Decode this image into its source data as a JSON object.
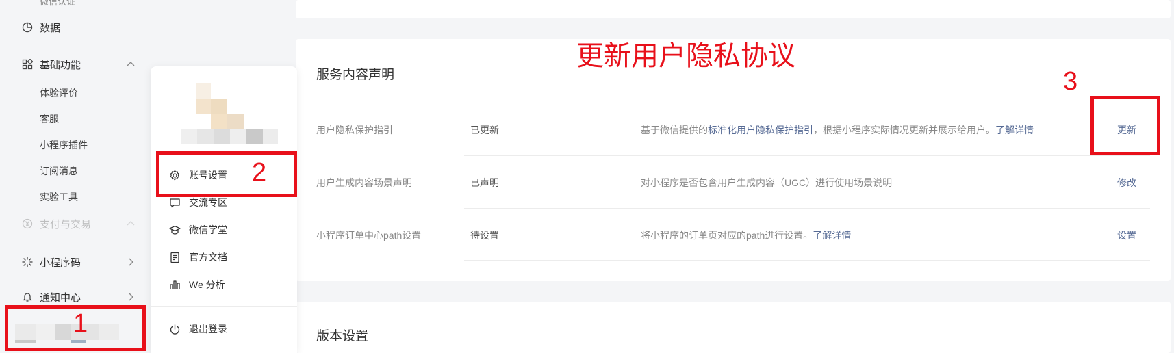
{
  "sidebar": {
    "top_item": "微信认证",
    "data_label": "数据",
    "basic_label": "基础功能",
    "basic_items": [
      "体验评价",
      "客服",
      "小程序插件",
      "订阅消息",
      "实验工具"
    ],
    "pay_label": "支付与交易",
    "qrcode_label": "小程序码",
    "notify_label": "通知中心"
  },
  "user_menu": {
    "items": [
      "账号设置",
      "交流专区",
      "微信学堂",
      "官方文档",
      "We 分析"
    ],
    "logout": "退出登录"
  },
  "service_card": {
    "title": "服务内容声明",
    "rows": [
      {
        "label": "用户隐私保护指引",
        "status": "已更新",
        "desc_pre": "基于微信提供的",
        "desc_link": "标准化用户隐私保护指引",
        "desc_mid": "，根据小程序实际情况更新并展示给用户。",
        "desc_link2": "了解详情",
        "action": "更新"
      },
      {
        "label": "用户生成内容场景声明",
        "status": "已声明",
        "desc_pre": "对小程序是否包含用户生成内容（UGC）进行使用场景说明",
        "action": "修改"
      },
      {
        "label": "小程序订单中心path设置",
        "status": "待设置",
        "desc_pre": "将小程序的订单页对应的path进行设置。",
        "desc_link2": "了解详情",
        "action": "设置"
      }
    ]
  },
  "version_card": {
    "title": "版本设置"
  },
  "annotations": {
    "title": "更新用户隐私协议",
    "n1": "1",
    "n2": "2",
    "n3": "3",
    "color": "#e8101a"
  },
  "colors": {
    "link": "#576b95",
    "background": "#f4f5f7"
  }
}
